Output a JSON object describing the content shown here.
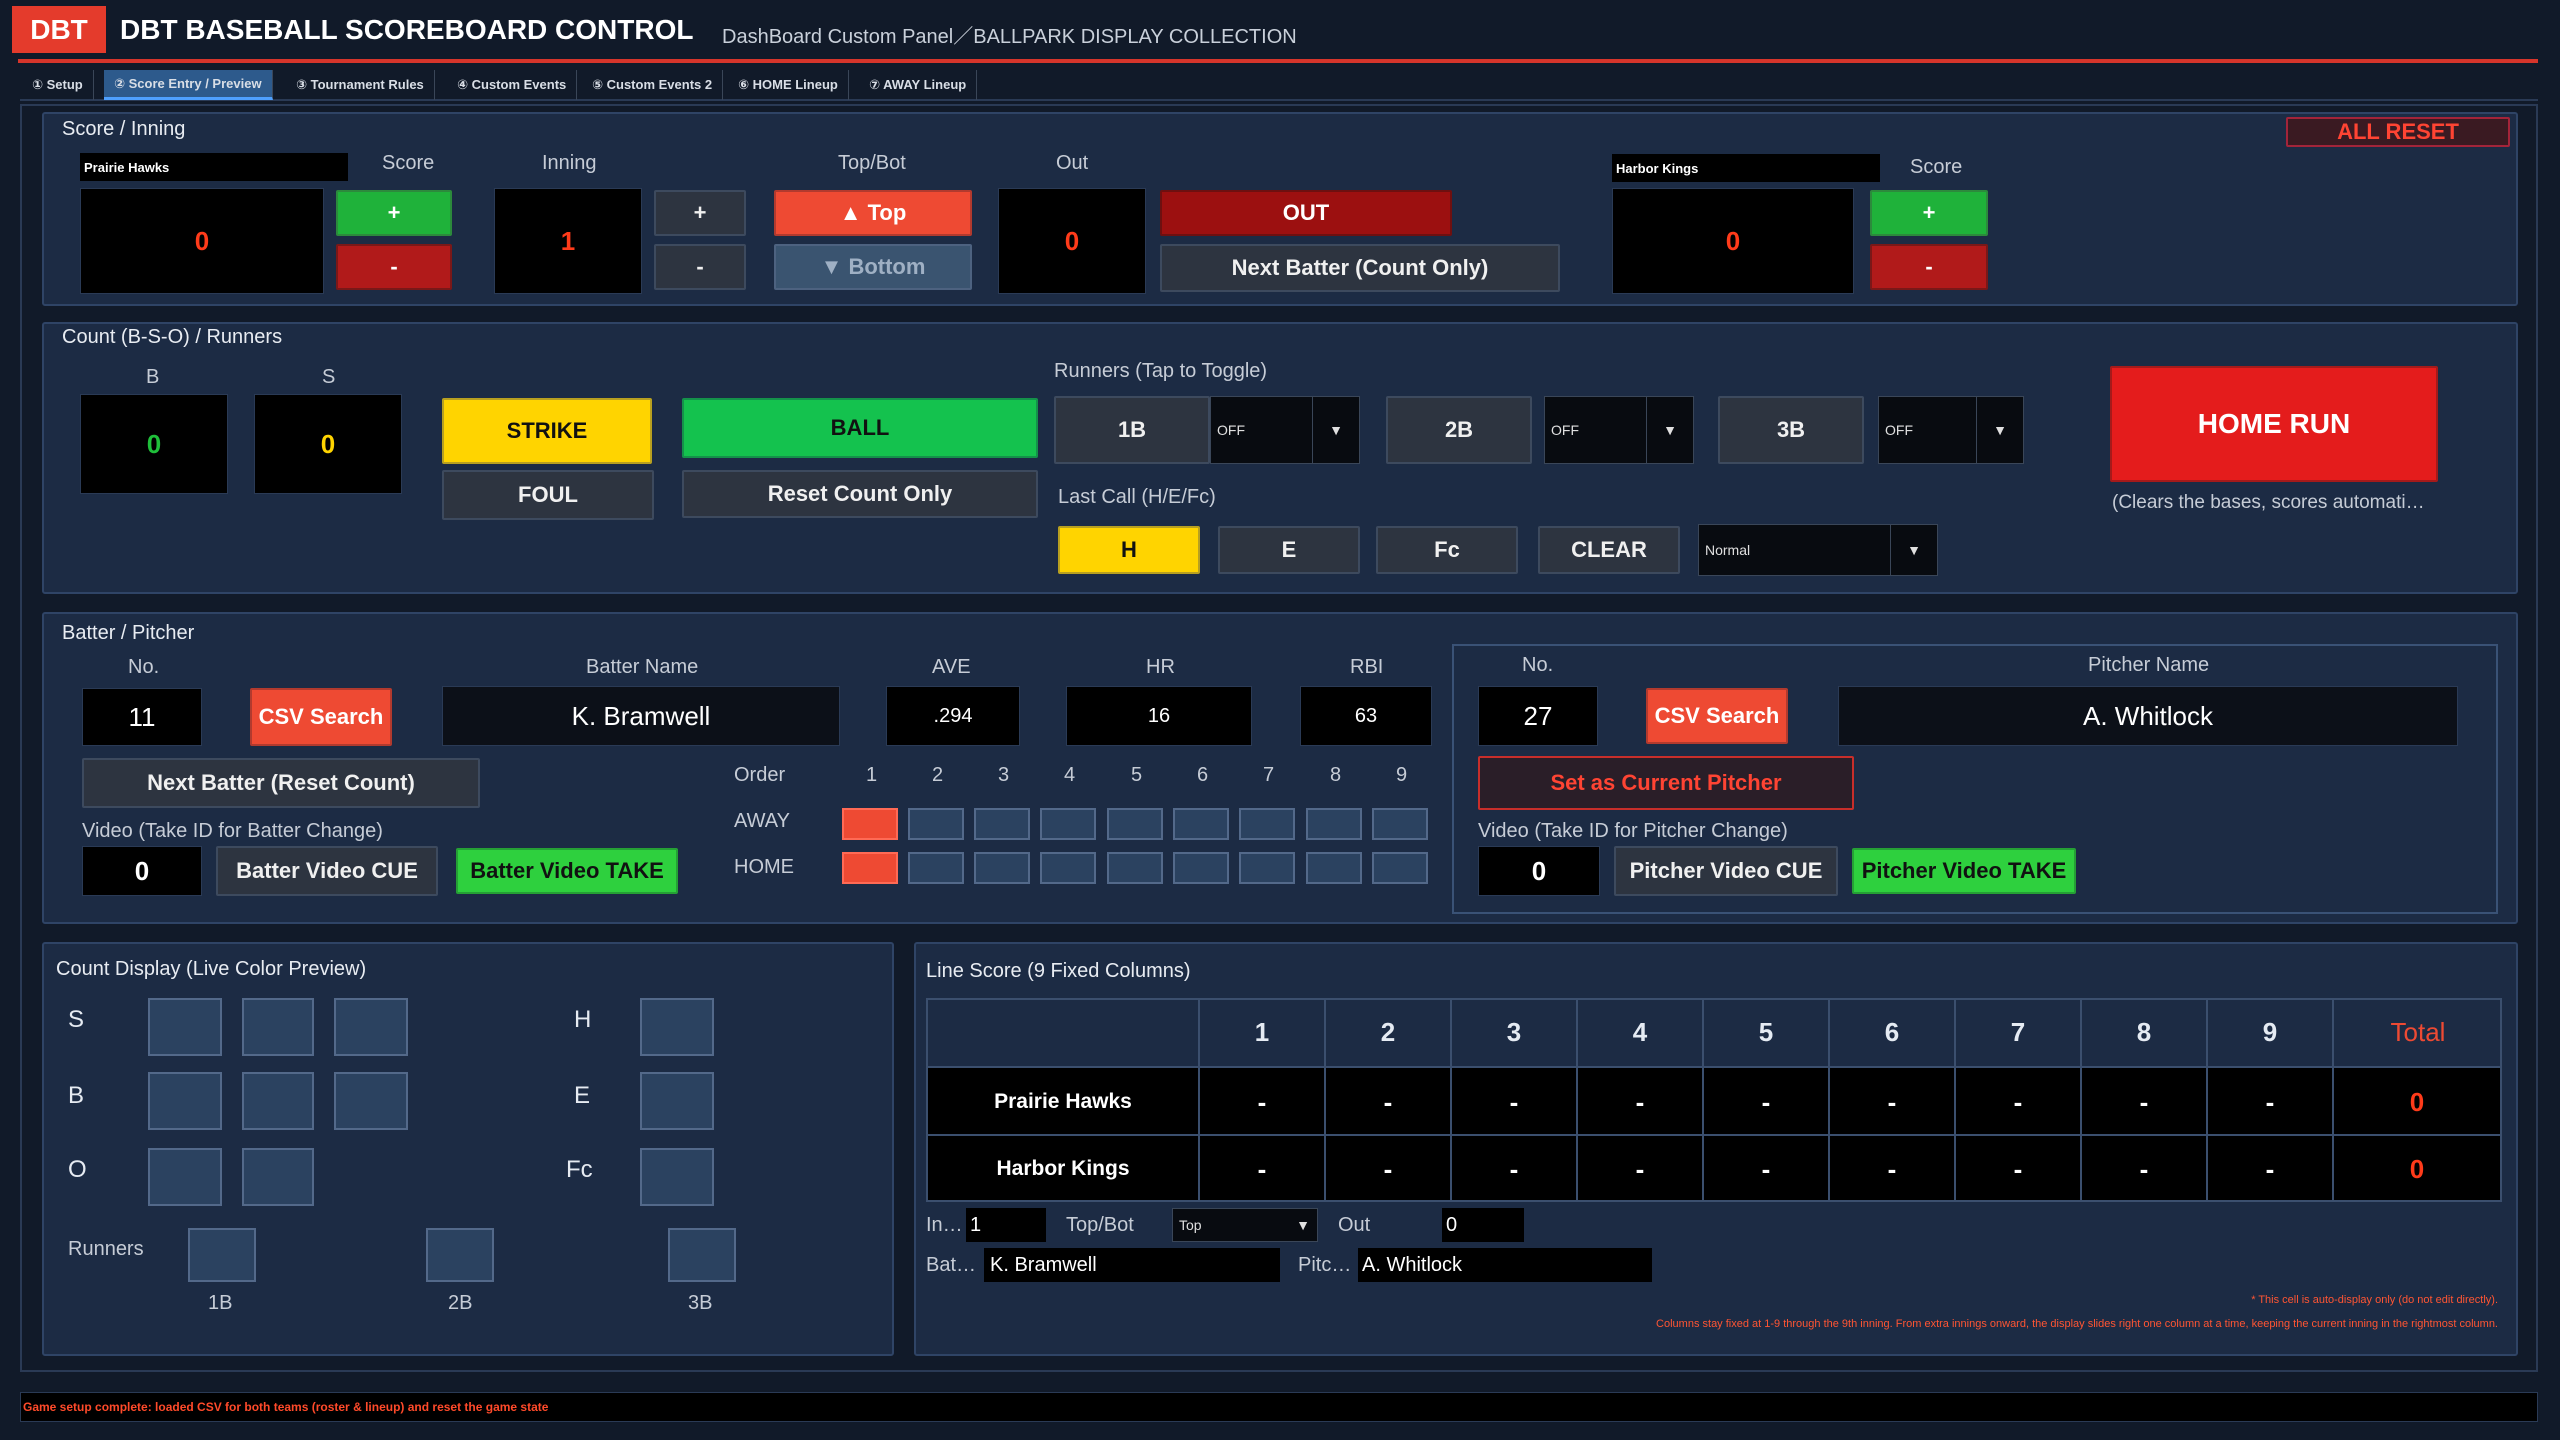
{
  "header": {
    "logo": "DBT",
    "title": "DBT BASEBALL SCOREBOARD CONTROL",
    "subtitle": "DashBoard Custom Panel／BALLPARK DISPLAY COLLECTION"
  },
  "tabs": [
    "① Setup",
    "② Score Entry / Preview",
    "③ Tournament Rules",
    "④ Custom Events",
    "⑤ Custom Events 2",
    "⑥ HOME Lineup",
    "⑦ AWAY Lineup"
  ],
  "score": {
    "title": "Score / Inning",
    "all_reset": "ALL RESET",
    "away_team": "Prairie Hawks",
    "home_team": "Harbor Kings",
    "score_label": "Score",
    "inning_label": "Inning",
    "topbot_label": "Top/Bot",
    "out_label": "Out",
    "away_score": "0",
    "home_score": "0",
    "inning": "1",
    "outs": "0",
    "plus": "+",
    "minus": "-",
    "top": "▲ Top",
    "bottom": "▼ Bottom",
    "out_btn": "OUT",
    "next_batter_count": "Next Batter (Count Only)"
  },
  "count": {
    "title": "Count (B-S-O) / Runners",
    "b_label": "B",
    "s_label": "S",
    "b_value": "0",
    "s_value": "0",
    "strike": "STRIKE",
    "ball": "BALL",
    "foul": "FOUL",
    "reset_count": "Reset Count Only",
    "runners_label": "Runners (Tap to Toggle)",
    "base1": "1B",
    "base2": "2B",
    "base3": "3B",
    "off1": "OFF",
    "off2": "OFF",
    "off3": "OFF",
    "last_call_label": "Last Call (H/E/Fc)",
    "h": "H",
    "e": "E",
    "fc": "Fc",
    "clear": "CLEAR",
    "mode": "Normal",
    "home_run": "HOME RUN",
    "home_run_note": "(Clears the bases, scores automati…"
  },
  "batter": {
    "title": "Batter / Pitcher",
    "no_label": "No.",
    "no": "11",
    "csv_search": "CSV Search",
    "name_label": "Batter Name",
    "name": "K. Bramwell",
    "ave_label": "AVE",
    "ave": ".294",
    "hr_label": "HR",
    "hr": "16",
    "rbi_label": "RBI",
    "rbi": "63",
    "next_batter": "Next Batter (Reset Count)",
    "video_label": "Video (Take ID for Batter Change)",
    "video_id": "0",
    "cue": "Batter Video CUE",
    "take": "Batter Video TAKE",
    "order_label": "Order",
    "orders": [
      "1",
      "2",
      "3",
      "4",
      "5",
      "6",
      "7",
      "8",
      "9"
    ],
    "away": "AWAY",
    "home": "HOME",
    "away_active": 1,
    "home_active": 1
  },
  "pitcher": {
    "no_label": "No.",
    "no": "27",
    "csv_search": "CSV Search",
    "name_label": "Pitcher Name",
    "name": "A. Whitlock",
    "set_current": "Set as Current Pitcher",
    "video_label": "Video (Take ID for Pitcher Change)",
    "video_id": "0",
    "cue": "Pitcher Video CUE",
    "take": "Pitcher Video TAKE"
  },
  "count_display": {
    "title": "Count Display (Live Color Preview)",
    "s": "S",
    "b": "B",
    "o": "O",
    "h": "H",
    "e": "E",
    "fc": "Fc",
    "runners": "Runners",
    "b1": "1B",
    "b2": "2B",
    "b3": "3B"
  },
  "line_score": {
    "title": "Line Score (9 Fixed Columns)",
    "innings": [
      "1",
      "2",
      "3",
      "4",
      "5",
      "6",
      "7",
      "8",
      "9"
    ],
    "total_label": "Total",
    "teams": [
      {
        "name": "Prairie Hawks",
        "runs": [
          "-",
          "-",
          "-",
          "-",
          "-",
          "-",
          "-",
          "-",
          "-"
        ],
        "total": "0"
      },
      {
        "name": "Harbor Kings",
        "runs": [
          "-",
          "-",
          "-",
          "-",
          "-",
          "-",
          "-",
          "-",
          "-"
        ],
        "total": "0"
      }
    ],
    "inning_label": "In…",
    "inning_value": "1",
    "topbot_label": "Top/Bot",
    "topbot_value": "Top",
    "out_label": "Out",
    "out_value": "0",
    "batter_label": "Bat…",
    "batter_value": "K. Bramwell",
    "pitcher_label": "Pitc…",
    "pitcher_value": "A. Whitlock",
    "note1": "* This cell is auto-display only (do not edit directly).",
    "note2": "Columns stay fixed at 1-9 through the 9th inning. From extra innings onward, the display slides right one column at a time, keeping the current inning in the rightmost column."
  },
  "status": "Game setup complete: loaded CSV for both teams (roster & lineup) and reset the game state",
  "colors": {
    "accent_red": "#e8442f",
    "green": "#1fbf3a",
    "yellow": "#ffd400",
    "navy": "#1c2b44"
  }
}
